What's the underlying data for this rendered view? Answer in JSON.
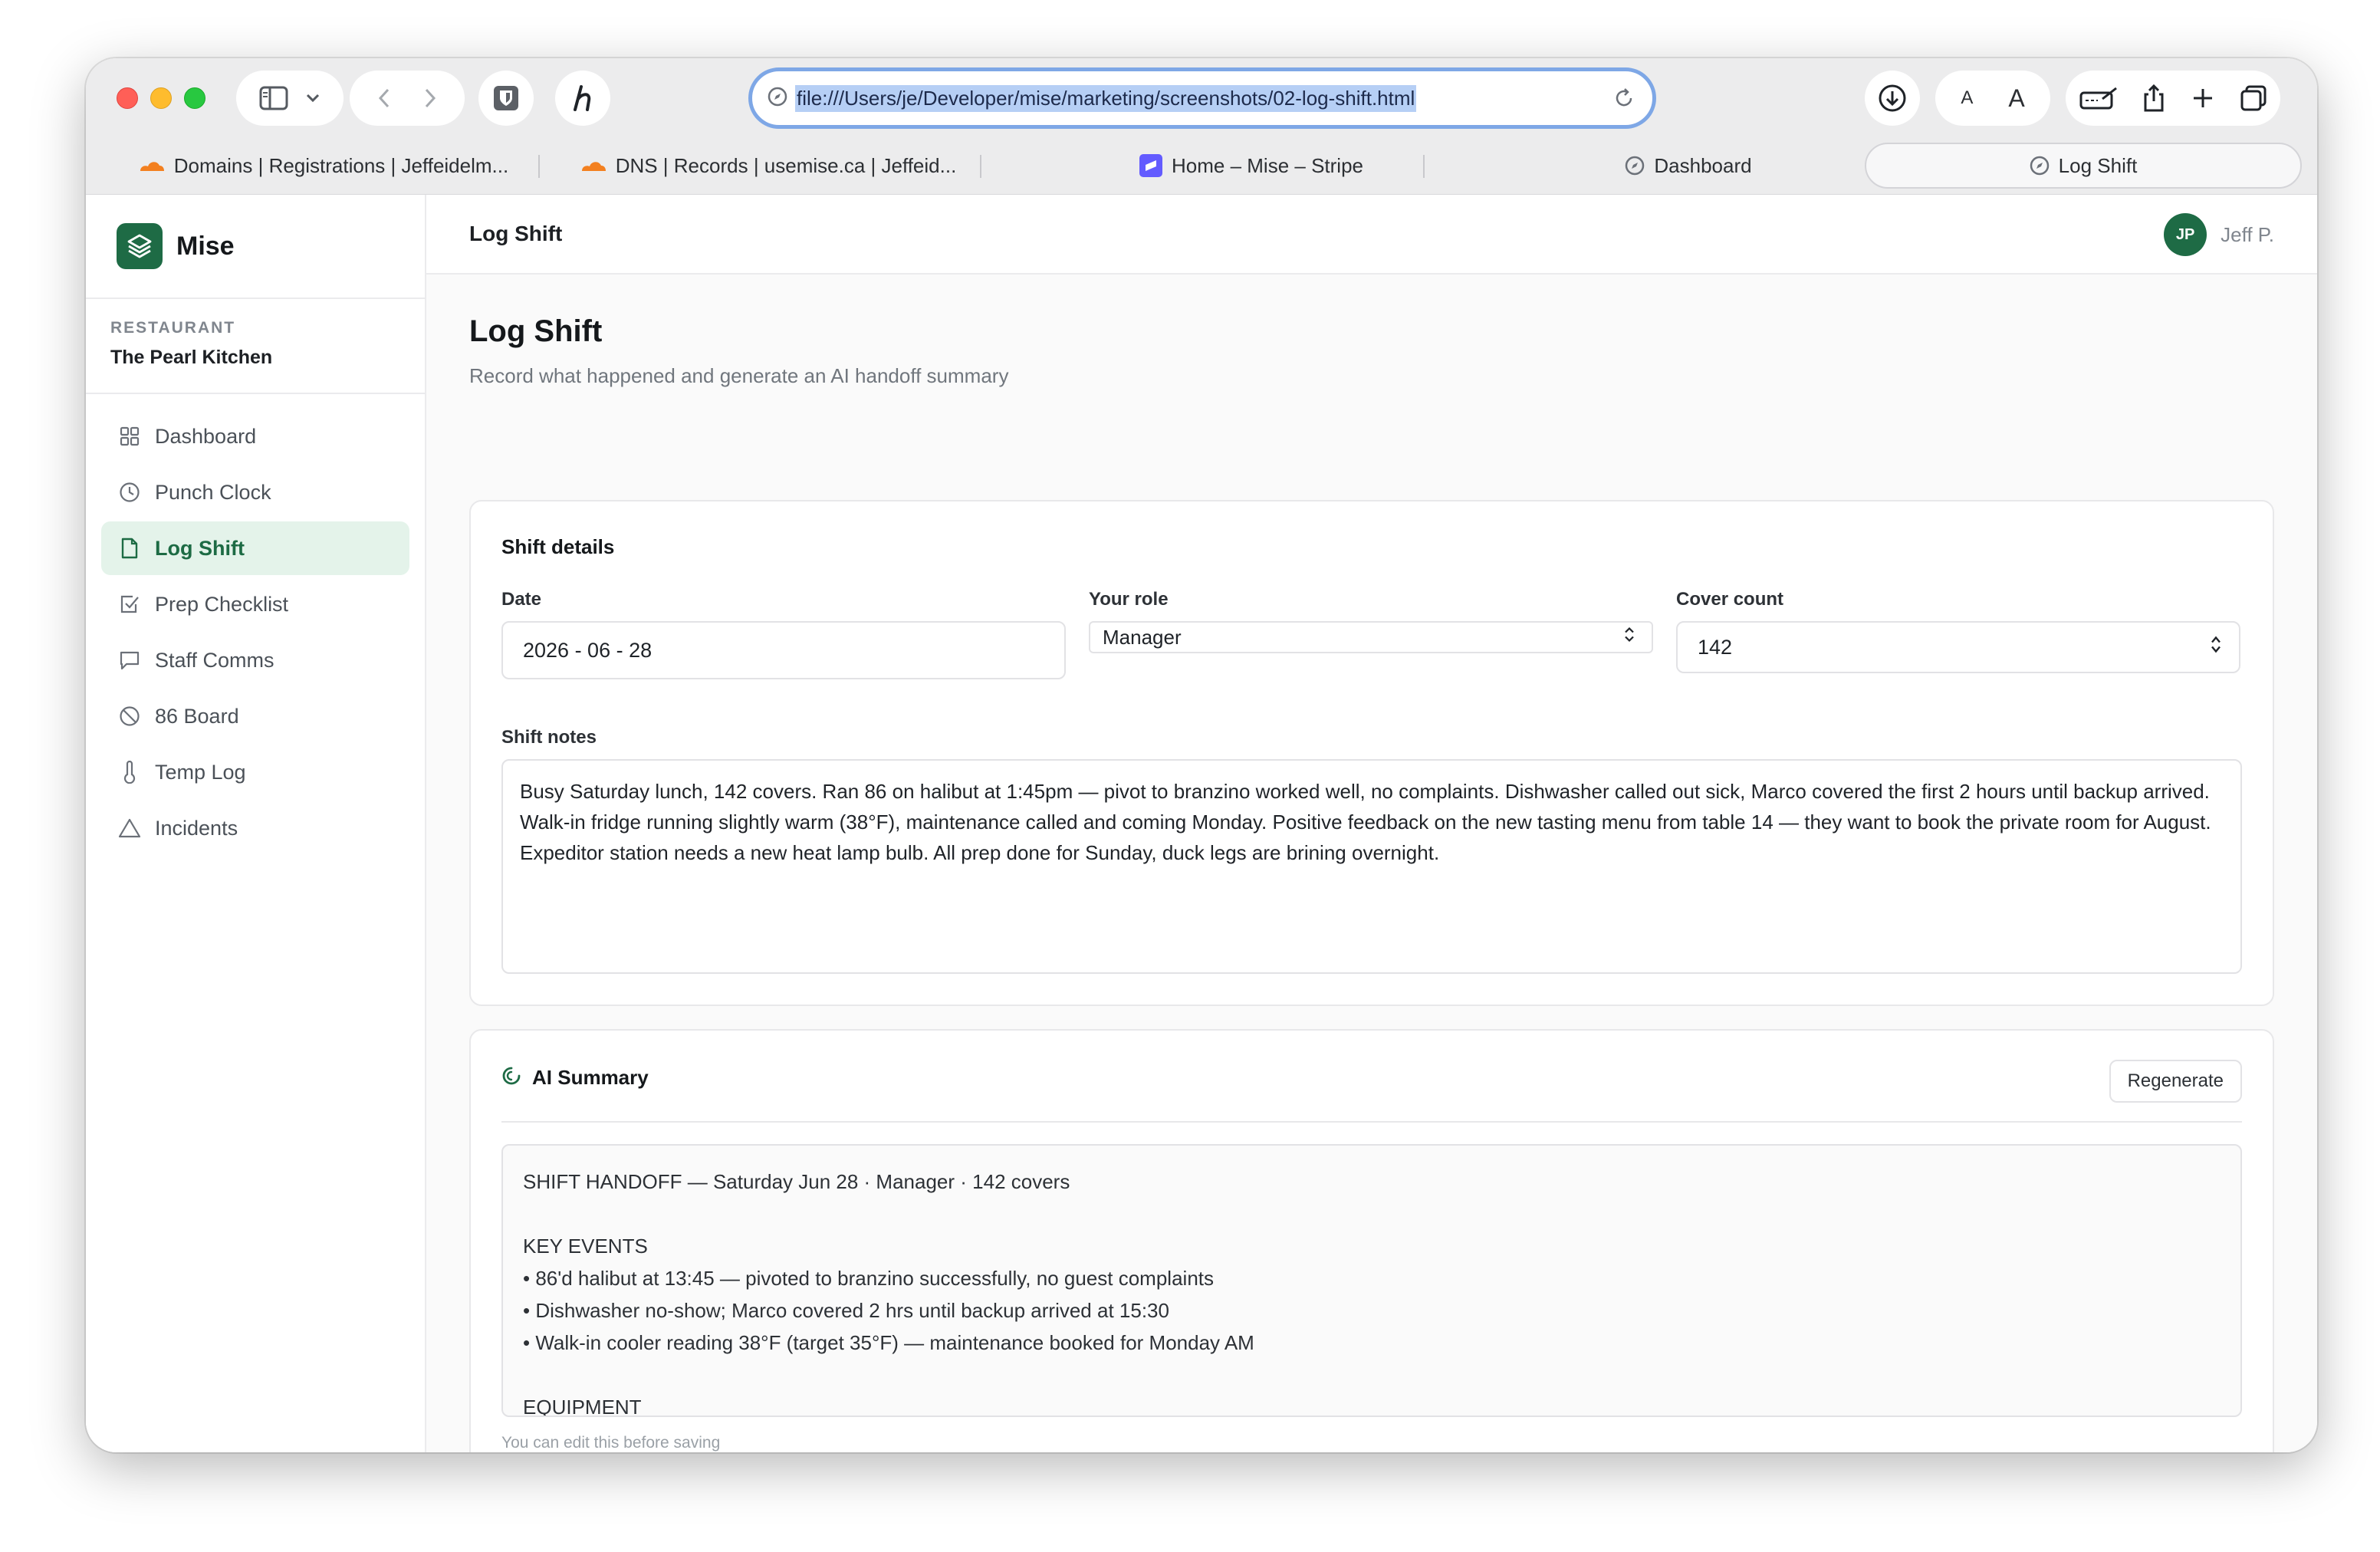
{
  "browser": {
    "url": "file:///Users/je/Developer/mise/marketing/screenshots/02-log-shift.html",
    "tabs": [
      {
        "label": "Domains | Registrations | Jeffeidelm...",
        "icon": "cloudflare-icon"
      },
      {
        "label": "DNS | Records | usemise.ca | Jeffeid...",
        "icon": "cloudflare-icon"
      },
      {
        "label": "Home – Mise – Stripe",
        "icon": "stripe-icon"
      },
      {
        "label": "Dashboard",
        "icon": "compass-icon"
      },
      {
        "label": "Log Shift",
        "icon": "compass-icon",
        "active": true
      }
    ],
    "text_size_small": "A",
    "text_size_large": "A"
  },
  "app": {
    "brand": "Mise",
    "restaurant_label": "RESTAURANT",
    "restaurant_name": "The Pearl Kitchen",
    "nav": [
      {
        "label": "Dashboard",
        "icon": "grid-icon"
      },
      {
        "label": "Punch Clock",
        "icon": "clock-icon"
      },
      {
        "label": "Log Shift",
        "icon": "document-icon",
        "active": true
      },
      {
        "label": "Prep Checklist",
        "icon": "checkbox-icon"
      },
      {
        "label": "Staff Comms",
        "icon": "message-icon"
      },
      {
        "label": "86 Board",
        "icon": "ban-icon"
      },
      {
        "label": "Temp Log",
        "icon": "thermometer-icon"
      },
      {
        "label": "Incidents",
        "icon": "warning-icon"
      }
    ],
    "header_title": "Log Shift",
    "user": {
      "initials": "JP",
      "name": "Jeff P."
    },
    "accent": "#1e6b45"
  },
  "page": {
    "title": "Log Shift",
    "subtitle": "Record what happened and generate an AI handoff summary",
    "shift_details": {
      "heading": "Shift details",
      "date_label": "Date",
      "date_value": "2026 - 06 - 28",
      "role_label": "Your role",
      "role_value": "Manager",
      "covers_label": "Cover count",
      "covers_value": "142",
      "notes_label": "Shift notes",
      "notes_value": "Busy Saturday lunch, 142 covers. Ran 86 on halibut at 1:45pm — pivot to branzino worked well, no complaints. Dishwasher called out sick, Marco covered the first 2 hours until backup arrived. Walk-in fridge running slightly warm (38°F), maintenance called and coming Monday. Positive feedback on the new tasting menu from table 14 — they want to book the private room for August. Expeditor station needs a new heat lamp bulb. All prep done for Sunday, duck legs are brining overnight."
    },
    "ai_summary": {
      "heading": "AI Summary",
      "regenerate_label": "Regenerate",
      "summary_text": "SHIFT HANDOFF — Saturday Jun 28 · Manager · 142 covers\n\nKEY EVENTS\n• 86'd halibut at 13:45 — pivoted to branzino successfully, no guest complaints\n• Dishwasher no-show; Marco covered 2 hrs until backup arrived at 15:30\n• Walk-in cooler reading 38°F (target 35°F) — maintenance booked for Monday AM\n\nEQUIPMENT",
      "hint": "You can edit this before saving"
    }
  }
}
